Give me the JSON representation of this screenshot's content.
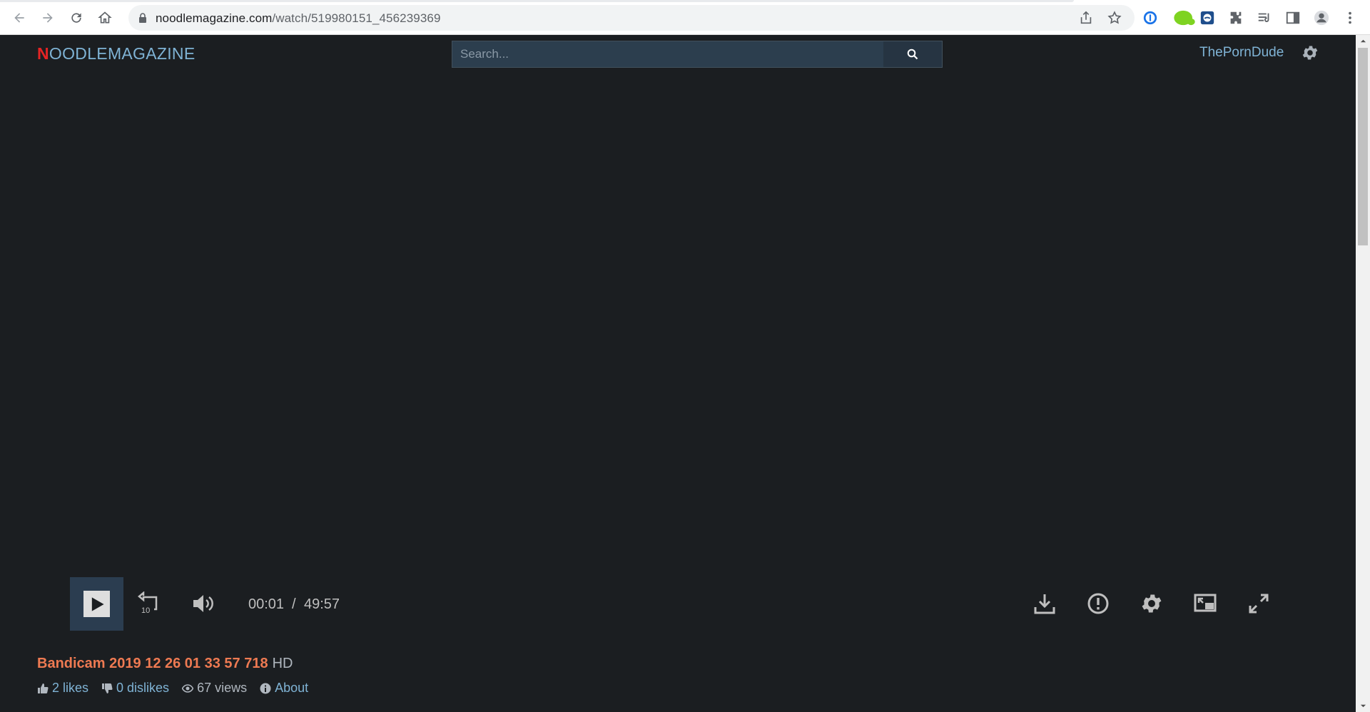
{
  "browser": {
    "url_domain": "noodlemagazine.com",
    "url_path": "/watch/519980151_456239369"
  },
  "site": {
    "logo_first": "N",
    "logo_rest": "OODLEMAGAZINE",
    "search_placeholder": "Search...",
    "partner_link": "ThePornDude"
  },
  "player": {
    "current_time": "00:01",
    "separator": "/",
    "duration": "49:57",
    "rewind_seconds": "10"
  },
  "video": {
    "title": "Bandicam 2019 12 26 01 33 57 718",
    "quality": "HD",
    "likes": "2 likes",
    "dislikes": "0 dislikes",
    "views": "67 views",
    "about": "About"
  },
  "colors": {
    "background": "#1b1e21",
    "link": "#7fb3d5",
    "title": "#ee7a52",
    "logo_accent": "#e52424",
    "play_button": "#2b3d50"
  }
}
